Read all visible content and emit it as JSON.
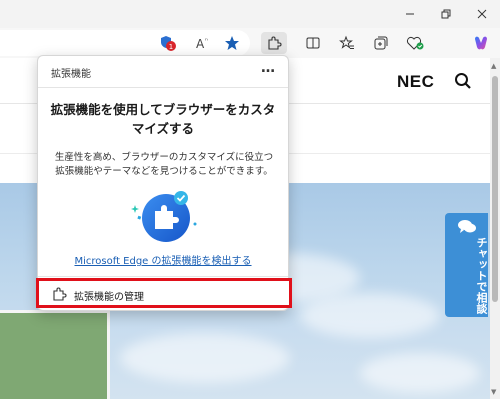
{
  "titlebar": {
    "minimize_icon": "minimize-icon",
    "restore_icon": "restore-icon",
    "close_icon": "close-icon"
  },
  "toolbar": {
    "icons": [
      "shield-badge-icon",
      "read-aloud-icon",
      "favorite-star-icon",
      "extensions-icon",
      "split-screen-icon",
      "favorites-icon",
      "collections-icon",
      "performance-icon",
      "copilot-icon"
    ],
    "badge_count": "1"
  },
  "page": {
    "logo": "NEC",
    "chat_tab": "チャットで相談"
  },
  "popup": {
    "title": "拡張機能",
    "more": "…",
    "heading": "拡張機能を使用してブラウザーをカスタマイズする",
    "description": "生産性を高め、ブラウザーのカスタマイズに役立つ拡張機能やテーマなどを見つけることができます。",
    "link": "Microsoft Edge の拡張機能を検出する",
    "manage": "拡張機能の管理"
  },
  "colors": {
    "accent": "#1a5fb4",
    "highlight": "#e0101a",
    "chat": "#3d8fd6"
  }
}
